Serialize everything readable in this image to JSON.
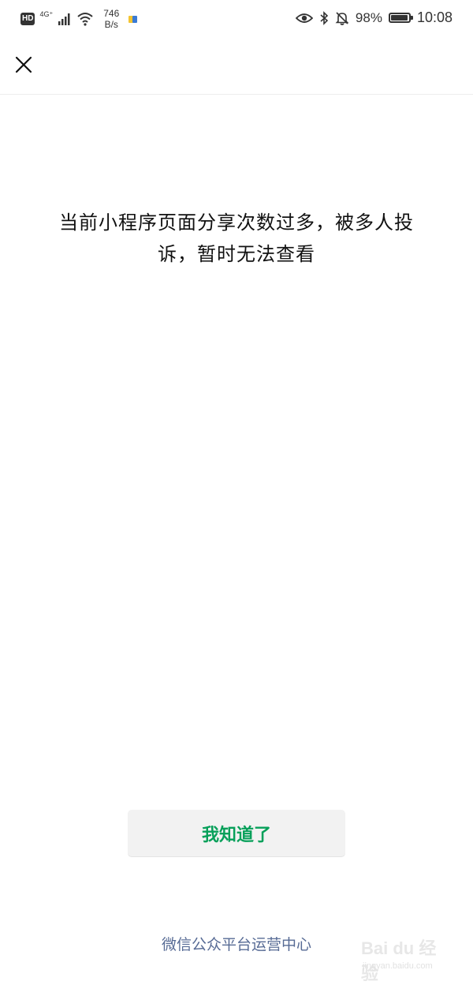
{
  "status_bar": {
    "hd_label": "HD",
    "network_label": "4G⁺",
    "speed_value": "746",
    "speed_unit": "B/s",
    "battery_percent": "98%",
    "battery_level": 0.98,
    "time": "10:08",
    "icons": [
      "signal-icon",
      "wifi-icon",
      "app-notification-icon",
      "eye-icon",
      "bluetooth-icon",
      "mute-bell-icon",
      "battery-icon"
    ]
  },
  "nav": {
    "close_icon": "close-icon"
  },
  "dialog": {
    "message": "当前小程序页面分享次数过多，被多人投诉，暂时无法查看",
    "button_label": "我知道了",
    "button_color": "#07a05a"
  },
  "footer": {
    "text": "微信公众平台运营中心",
    "color": "#576b95"
  },
  "watermark": {
    "main": "Bai du 经验",
    "sub": "jingyan.baidu.com"
  }
}
